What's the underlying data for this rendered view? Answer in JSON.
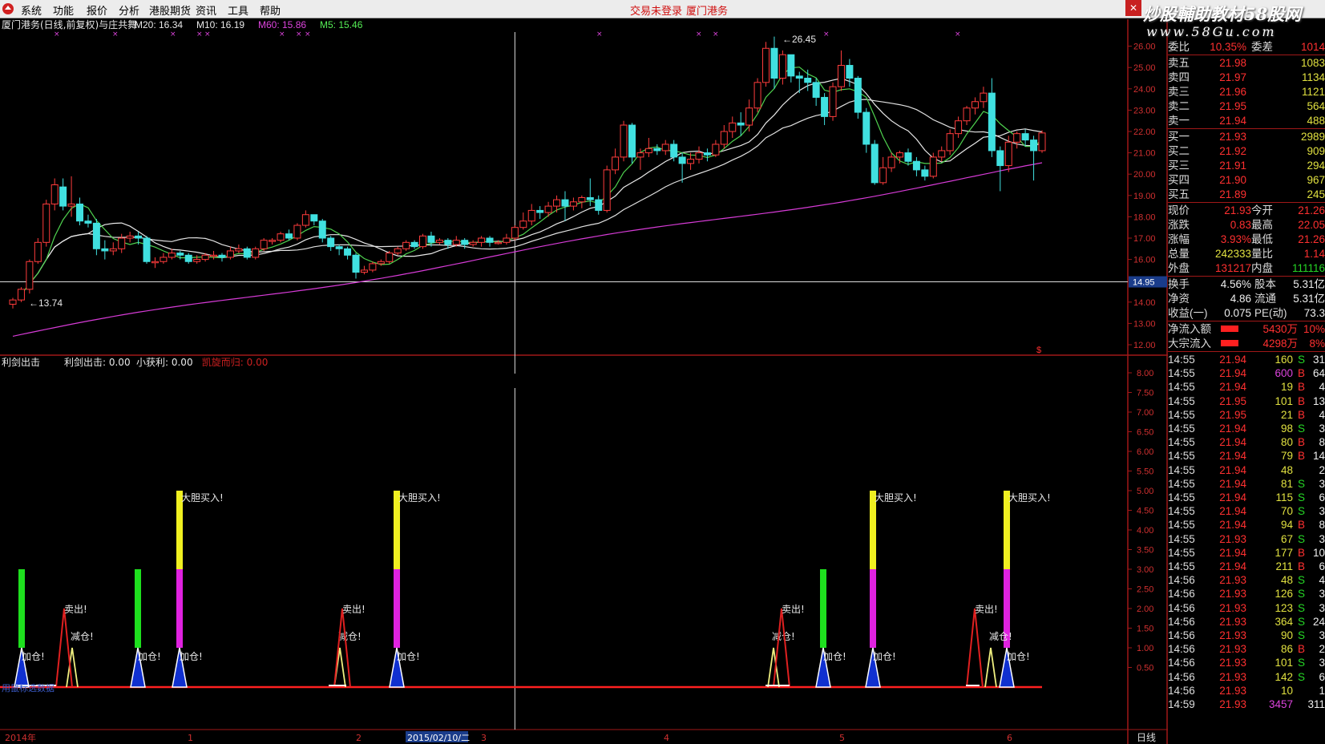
{
  "menubar": {
    "items": [
      "系统",
      "功能",
      "报价",
      "分析",
      "港股期货",
      "资讯",
      "工具",
      "帮助"
    ],
    "trade_status": "交易未登录",
    "broker": "厦门港务"
  },
  "watermark": {
    "line1": "炒股輔助教材58股网",
    "line2": "www.58Gu.com"
  },
  "main_panel": {
    "title": "厦门港务(日线,前复权)与庄共舞",
    "ma_labels": [
      {
        "text": "M20: 16.34",
        "color": "#e8e8e8"
      },
      {
        "text": "M10: 16.19",
        "color": "#e8e8e8"
      },
      {
        "text": "M60: 15.86",
        "color": "#dd44dd"
      },
      {
        "text": "M5: 15.46",
        "color": "#55ee55"
      }
    ],
    "high_label": "26.45",
    "low_label": "13.74",
    "crosshair_value": "14.95",
    "y_ticks": [
      "26.00",
      "25.00",
      "24.00",
      "23.00",
      "22.00",
      "21.00",
      "20.00",
      "19.00",
      "18.00",
      "17.00",
      "16.00",
      "15.00",
      "14.00",
      "13.00",
      "12.00"
    ]
  },
  "sub_panel": {
    "name": "利剑出击",
    "indicators": [
      {
        "text": "利剑出击: 0.00",
        "color": "#e8e8e8"
      },
      {
        "text": "小获利: 0.00",
        "color": "#e8e8e8"
      },
      {
        "text": "凯旋而归: 0.00",
        "color": "#cc2020"
      }
    ],
    "y_ticks": [
      "8.00",
      "7.50",
      "7.00",
      "6.50",
      "6.00",
      "5.50",
      "5.00",
      "4.50",
      "4.00",
      "3.50",
      "3.00",
      "2.50",
      "2.00",
      "1.50",
      "1.00",
      "0.50"
    ],
    "big_buy_label": "大胆买入!",
    "sell_label": "卖出!",
    "reduce_label": "减仓!",
    "add_label": "加仓!",
    "bottom_left_label": "用鼠标选数据"
  },
  "x_axis": {
    "labels": [
      {
        "text": "2014年",
        "x": 6
      },
      {
        "text": "1",
        "x": 234
      },
      {
        "text": "2",
        "x": 444
      },
      {
        "text": "2015/02/10/二",
        "x": 508
      },
      {
        "text": "3",
        "x": 600
      },
      {
        "text": "4",
        "x": 828
      },
      {
        "text": "5",
        "x": 1047
      },
      {
        "text": "6",
        "x": 1256
      }
    ],
    "period": "日线"
  },
  "order_book": {
    "ratio": {
      "label": "委比",
      "value": "10.35%",
      "diff_label": "委差",
      "diff_value": "1014"
    },
    "asks": [
      {
        "label": "卖五",
        "price": "21.98",
        "vol": "1083"
      },
      {
        "label": "卖四",
        "price": "21.97",
        "vol": "1134"
      },
      {
        "label": "卖三",
        "price": "21.96",
        "vol": "1121"
      },
      {
        "label": "卖二",
        "price": "21.95",
        "vol": "564"
      },
      {
        "label": "卖一",
        "price": "21.94",
        "vol": "488"
      }
    ],
    "bids": [
      {
        "label": "买一",
        "price": "21.93",
        "vol": "2989"
      },
      {
        "label": "买二",
        "price": "21.92",
        "vol": "909"
      },
      {
        "label": "买三",
        "price": "21.91",
        "vol": "294"
      },
      {
        "label": "买四",
        "price": "21.90",
        "vol": "967"
      },
      {
        "label": "买五",
        "price": "21.89",
        "vol": "245"
      }
    ]
  },
  "quote": [
    {
      "l1": "现价",
      "v1": "21.93",
      "c1": "red",
      "l2": "今开",
      "v2": "21.26",
      "c2": "red"
    },
    {
      "l1": "涨跌",
      "v1": "0.83",
      "c1": "red",
      "l2": "最高",
      "v2": "22.05",
      "c2": "red"
    },
    {
      "l1": "涨幅",
      "v1": "3.93%",
      "c1": "red",
      "l2": "最低",
      "v2": "21.26",
      "c2": "red"
    },
    {
      "l1": "总量",
      "v1": "242333",
      "c1": "yel",
      "l2": "量比",
      "v2": "1.14",
      "c2": "red"
    },
    {
      "l1": "外盘",
      "v1": "131217",
      "c1": "red",
      "l2": "内盘",
      "v2": "111116",
      "c2": "grn"
    }
  ],
  "fundamentals": [
    {
      "l1": "换手",
      "v1": "4.56%",
      "l2": "股本",
      "v2": "5.31亿"
    },
    {
      "l1": "净资",
      "v1": "4.86",
      "l2": "流通",
      "v2": "5.31亿"
    },
    {
      "l1": "收益(一)",
      "v1": "0.075",
      "l2": "PE(动)",
      "v2": "73.3"
    }
  ],
  "flows": [
    {
      "label": "净流入额",
      "value": "5430万",
      "pct": "10%"
    },
    {
      "label": "大宗流入",
      "value": "4298万",
      "pct": "8%"
    }
  ],
  "ticks": [
    {
      "t": "14:55",
      "p": "21.94",
      "v": "160",
      "s": "S",
      "n": "31"
    },
    {
      "t": "14:55",
      "p": "21.94",
      "v": "600",
      "s": "B",
      "n": "64"
    },
    {
      "t": "14:55",
      "p": "21.94",
      "v": "19",
      "s": "B",
      "n": "4"
    },
    {
      "t": "14:55",
      "p": "21.95",
      "v": "101",
      "s": "B",
      "n": "13"
    },
    {
      "t": "14:55",
      "p": "21.95",
      "v": "21",
      "s": "B",
      "n": "4"
    },
    {
      "t": "14:55",
      "p": "21.94",
      "v": "98",
      "s": "S",
      "n": "3"
    },
    {
      "t": "14:55",
      "p": "21.94",
      "v": "80",
      "s": "B",
      "n": "8"
    },
    {
      "t": "14:55",
      "p": "21.94",
      "v": "79",
      "s": "B",
      "n": "14"
    },
    {
      "t": "14:55",
      "p": "21.94",
      "v": "48",
      "s": "",
      "n": "2"
    },
    {
      "t": "14:55",
      "p": "21.94",
      "v": "81",
      "s": "S",
      "n": "3"
    },
    {
      "t": "14:55",
      "p": "21.94",
      "v": "115",
      "s": "S",
      "n": "6"
    },
    {
      "t": "14:55",
      "p": "21.94",
      "v": "70",
      "s": "S",
      "n": "3"
    },
    {
      "t": "14:55",
      "p": "21.94",
      "v": "94",
      "s": "B",
      "n": "8"
    },
    {
      "t": "14:55",
      "p": "21.93",
      "v": "67",
      "s": "S",
      "n": "3"
    },
    {
      "t": "14:55",
      "p": "21.94",
      "v": "177",
      "s": "B",
      "n": "10"
    },
    {
      "t": "14:55",
      "p": "21.94",
      "v": "211",
      "s": "B",
      "n": "6"
    },
    {
      "t": "14:56",
      "p": "21.93",
      "v": "48",
      "s": "S",
      "n": "4"
    },
    {
      "t": "14:56",
      "p": "21.93",
      "v": "126",
      "s": "S",
      "n": "3"
    },
    {
      "t": "14:56",
      "p": "21.93",
      "v": "123",
      "s": "S",
      "n": "3"
    },
    {
      "t": "14:56",
      "p": "21.93",
      "v": "364",
      "s": "S",
      "n": "24"
    },
    {
      "t": "14:56",
      "p": "21.93",
      "v": "90",
      "s": "S",
      "n": "3"
    },
    {
      "t": "14:56",
      "p": "21.93",
      "v": "86",
      "s": "B",
      "n": "2"
    },
    {
      "t": "14:56",
      "p": "21.93",
      "v": "101",
      "s": "S",
      "n": "3"
    },
    {
      "t": "14:56",
      "p": "21.93",
      "v": "142",
      "s": "S",
      "n": "6"
    },
    {
      "t": "14:56",
      "p": "21.93",
      "v": "10",
      "s": "",
      "n": "1"
    },
    {
      "t": "14:59",
      "p": "21.93",
      "v": "3457",
      "s": "",
      "n": "311"
    }
  ],
  "chart_data": {
    "type": "candlestick",
    "y_range": [
      11.6,
      26.8
    ],
    "candles": [
      [
        13.9,
        14.1,
        13.7,
        14.2
      ],
      [
        14.1,
        14.6,
        14.0,
        14.7
      ],
      [
        14.6,
        15.9,
        14.4,
        16.0
      ],
      [
        15.9,
        16.8,
        15.8,
        17.0
      ],
      [
        16.8,
        18.6,
        16.6,
        18.8
      ],
      [
        18.6,
        19.5,
        18.3,
        19.8
      ],
      [
        19.4,
        18.5,
        18.3,
        19.8
      ],
      [
        18.5,
        18.6,
        18.0,
        19.9
      ],
      [
        18.6,
        17.8,
        17.6,
        18.9
      ],
      [
        17.8,
        17.7,
        17.5,
        18.1
      ],
      [
        17.7,
        16.5,
        16.2,
        17.9
      ],
      [
        16.5,
        16.4,
        16.0,
        16.9
      ],
      [
        16.4,
        16.5,
        16.2,
        16.8
      ],
      [
        16.5,
        17.0,
        16.3,
        17.2
      ],
      [
        17.0,
        17.1,
        16.8,
        17.3
      ],
      [
        17.1,
        17.0,
        16.7,
        17.3
      ],
      [
        17.0,
        15.9,
        15.8,
        17.1
      ],
      [
        15.9,
        15.9,
        15.6,
        16.1
      ],
      [
        15.9,
        16.1,
        15.8,
        16.3
      ],
      [
        16.1,
        16.3,
        16.0,
        16.5
      ],
      [
        16.3,
        16.2,
        16.0,
        16.4
      ],
      [
        16.2,
        15.9,
        15.8,
        16.3
      ],
      [
        15.9,
        16.0,
        15.8,
        16.2
      ],
      [
        16.0,
        16.2,
        15.9,
        16.3
      ],
      [
        16.2,
        16.2,
        16.0,
        16.4
      ],
      [
        16.2,
        16.1,
        15.9,
        16.3
      ],
      [
        16.1,
        16.4,
        16.0,
        16.6
      ],
      [
        16.4,
        16.5,
        16.3,
        16.7
      ],
      [
        16.5,
        16.1,
        16.0,
        16.6
      ],
      [
        16.1,
        16.5,
        16.0,
        16.6
      ],
      [
        16.5,
        16.9,
        16.4,
        17.0
      ],
      [
        16.9,
        16.9,
        16.7,
        17.0
      ],
      [
        16.9,
        17.2,
        16.8,
        17.3
      ],
      [
        17.2,
        17.0,
        16.9,
        17.4
      ],
      [
        17.0,
        17.6,
        16.9,
        17.7
      ],
      [
        17.6,
        18.1,
        17.5,
        18.3
      ],
      [
        18.1,
        17.8,
        17.6,
        18.1
      ],
      [
        17.8,
        17.0,
        16.8,
        17.9
      ],
      [
        17.0,
        16.6,
        16.4,
        17.1
      ],
      [
        16.6,
        16.5,
        16.2,
        16.7
      ],
      [
        16.5,
        16.2,
        16.0,
        16.6
      ],
      [
        16.2,
        15.4,
        15.1,
        16.3
      ],
      [
        15.4,
        15.5,
        15.3,
        15.7
      ],
      [
        15.5,
        15.8,
        15.4,
        15.9
      ],
      [
        15.8,
        15.9,
        15.7,
        16.0
      ],
      [
        15.9,
        16.3,
        15.8,
        16.4
      ],
      [
        16.3,
        16.5,
        16.2,
        16.6
      ],
      [
        16.5,
        16.8,
        16.4,
        16.9
      ],
      [
        16.8,
        16.6,
        16.5,
        16.9
      ],
      [
        16.6,
        17.1,
        16.5,
        17.2
      ],
      [
        17.1,
        16.8,
        16.6,
        17.3
      ],
      [
        16.8,
        16.9,
        16.7,
        17.0
      ],
      [
        16.9,
        16.7,
        16.5,
        17.0
      ],
      [
        16.7,
        16.9,
        16.6,
        17.1
      ],
      [
        16.9,
        16.7,
        16.5,
        17.0
      ],
      [
        16.7,
        16.8,
        16.6,
        16.9
      ],
      [
        16.8,
        17.0,
        16.6,
        17.1
      ],
      [
        17.0,
        16.8,
        16.6,
        17.1
      ],
      [
        16.8,
        16.8,
        16.7,
        16.9
      ],
      [
        16.8,
        17.0,
        16.7,
        17.2
      ],
      [
        17.0,
        17.5,
        16.9,
        17.6
      ],
      [
        17.5,
        17.8,
        17.4,
        18.2
      ],
      [
        17.8,
        18.3,
        17.6,
        18.6
      ],
      [
        18.3,
        18.2,
        17.9,
        18.5
      ],
      [
        18.2,
        18.5,
        18.0,
        18.7
      ],
      [
        18.5,
        18.8,
        18.2,
        19.0
      ],
      [
        18.8,
        18.5,
        17.8,
        19.2
      ],
      [
        18.5,
        18.7,
        18.3,
        18.9
      ],
      [
        18.7,
        18.9,
        18.4,
        19.0
      ],
      [
        18.9,
        18.8,
        18.5,
        19.8
      ],
      [
        18.8,
        18.3,
        18.1,
        19.0
      ],
      [
        18.3,
        20.2,
        18.2,
        20.4
      ],
      [
        20.2,
        20.8,
        20.0,
        21.2
      ],
      [
        20.8,
        22.3,
        20.6,
        22.5
      ],
      [
        22.3,
        20.8,
        20.5,
        22.4
      ],
      [
        20.8,
        21.0,
        20.2,
        21.2
      ],
      [
        21.0,
        21.2,
        20.8,
        21.7
      ],
      [
        21.2,
        21.1,
        20.9,
        21.4
      ],
      [
        21.1,
        21.4,
        20.9,
        21.6
      ],
      [
        21.4,
        20.8,
        20.6,
        21.6
      ],
      [
        20.8,
        20.5,
        19.6,
        21.0
      ],
      [
        20.5,
        20.7,
        20.2,
        21.0
      ],
      [
        20.7,
        21.0,
        20.5,
        21.3
      ],
      [
        21.0,
        20.9,
        20.6,
        21.2
      ],
      [
        20.9,
        21.4,
        20.8,
        21.6
      ],
      [
        21.4,
        22.0,
        21.2,
        22.3
      ],
      [
        22.0,
        22.4,
        21.7,
        22.7
      ],
      [
        22.4,
        22.3,
        21.8,
        22.9
      ],
      [
        22.3,
        23.1,
        22.0,
        23.5
      ],
      [
        23.1,
        24.3,
        22.9,
        24.5
      ],
      [
        24.3,
        25.9,
        24.1,
        26.2
      ],
      [
        25.9,
        24.5,
        24.0,
        26.45
      ],
      [
        24.5,
        25.6,
        24.2,
        25.8
      ],
      [
        25.6,
        24.6,
        24.3,
        25.2
      ],
      [
        24.6,
        24.5,
        23.8,
        24.8
      ],
      [
        24.5,
        24.3,
        23.9,
        24.9
      ],
      [
        24.3,
        23.6,
        23.2,
        24.5
      ],
      [
        23.6,
        22.7,
        22.3,
        23.8
      ],
      [
        22.7,
        24.1,
        22.5,
        24.3
      ],
      [
        24.1,
        25.1,
        23.9,
        25.8
      ],
      [
        25.1,
        24.5,
        24.1,
        25.4
      ],
      [
        24.5,
        22.9,
        22.6,
        24.6
      ],
      [
        22.9,
        21.4,
        21.0,
        23.1
      ],
      [
        21.4,
        19.6,
        19.5,
        21.6
      ],
      [
        19.6,
        20.3,
        19.5,
        20.8
      ],
      [
        20.3,
        20.8,
        20.1,
        21.0
      ],
      [
        20.8,
        21.0,
        20.5,
        21.1
      ],
      [
        21.0,
        20.6,
        20.4,
        21.2
      ],
      [
        20.6,
        20.2,
        19.9,
        20.8
      ],
      [
        20.2,
        19.9,
        19.7,
        20.4
      ],
      [
        19.9,
        20.8,
        19.8,
        21.0
      ],
      [
        20.8,
        21.1,
        20.6,
        21.3
      ],
      [
        21.1,
        21.9,
        20.9,
        22.1
      ],
      [
        21.9,
        22.5,
        21.7,
        22.7
      ],
      [
        22.5,
        23.1,
        22.3,
        23.2
      ],
      [
        23.1,
        23.4,
        22.8,
        23.6
      ],
      [
        23.4,
        23.8,
        23.1,
        24.1
      ],
      [
        23.8,
        21.1,
        20.8,
        24.5
      ],
      [
        21.1,
        20.4,
        19.2,
        21.3
      ],
      [
        20.4,
        21.5,
        20.1,
        21.8
      ],
      [
        21.5,
        21.9,
        21.2,
        22.0
      ],
      [
        21.9,
        21.6,
        21.3,
        22.1
      ],
      [
        21.6,
        21.1,
        19.7,
        21.8
      ],
      [
        21.1,
        21.93,
        21.0,
        22.05
      ]
    ]
  }
}
